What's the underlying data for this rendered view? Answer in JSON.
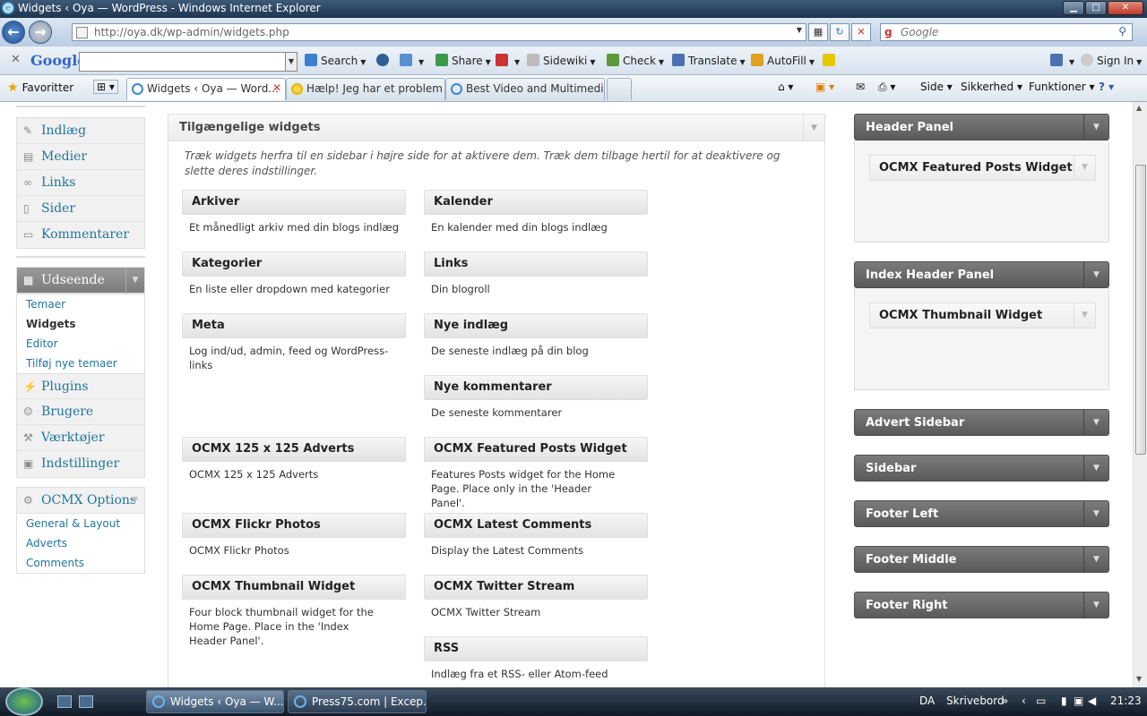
{
  "window": {
    "title": "Widgets ‹ Oya — WordPress - Windows Internet Explorer",
    "controls": {
      "minimize": "▁",
      "maximize": "□",
      "close": "✕"
    }
  },
  "address_bar": {
    "url": "http://oya.dk/wp-admin/widgets.php",
    "search_placeholder": "Google"
  },
  "google_toolbar": {
    "logo": "Google",
    "items": [
      "Search",
      "Share",
      "Sidewiki",
      "Check",
      "Translate",
      "AutoFill"
    ],
    "sign_in": "Sign In"
  },
  "favorites_bar": {
    "favorites_label": "Favoritter",
    "tabs": [
      {
        "label": "Widgets ‹ Oya — Word..."
      },
      {
        "label": "Hælp! Jeg har et problem ..."
      },
      {
        "label": "Best Video and Multimedi..."
      }
    ],
    "commands": [
      "Side",
      "Sikkerhed",
      "Funktioner"
    ]
  },
  "admin_menu": {
    "group1": [
      {
        "label": "Indlæg",
        "icon": "pin-icon"
      },
      {
        "label": "Medier",
        "icon": "media-icon"
      },
      {
        "label": "Links",
        "icon": "link-icon"
      },
      {
        "label": "Sider",
        "icon": "pages-icon"
      },
      {
        "label": "Kommentarer",
        "icon": "comments-icon"
      }
    ],
    "appearance": {
      "label": "Udseende",
      "sub": [
        "Temaer",
        "Widgets",
        "Editor",
        "Tilføj nye temaer"
      ]
    },
    "group2": [
      {
        "label": "Plugins"
      },
      {
        "label": "Brugere"
      },
      {
        "label": "Værktøjer"
      },
      {
        "label": "Indstillinger"
      }
    ],
    "ocmx": {
      "label": "OCMX Options",
      "sub": [
        "General & Layout",
        "Adverts",
        "Comments"
      ]
    }
  },
  "available": {
    "title": "Tilgængelige widgets",
    "description": "Træk widgets herfra til en sidebar i højre side for at aktivere dem. Træk dem tilbage hertil for at deaktivere og slette deres indstillinger.",
    "widgets": [
      {
        "title": "Arkiver",
        "desc": "Et månedligt arkiv med din blogs indlæg"
      },
      {
        "title": "Kalender",
        "desc": "En kalender med din blogs indlæg"
      },
      {
        "title": "Kategorier",
        "desc": "En liste eller dropdown med kategorier"
      },
      {
        "title": "Links",
        "desc": "Din blogroll"
      },
      {
        "title": "Meta",
        "desc": "Log ind/ud, admin, feed og WordPress-links"
      },
      {
        "title": "Nye indlæg",
        "desc": "De seneste indlæg på din blog"
      },
      {
        "title": "Nye kommentarer",
        "desc": "De seneste kommentarer"
      },
      {
        "title": "OCMX 125 x 125 Adverts",
        "desc": "OCMX 125 x 125 Adverts"
      },
      {
        "title": "OCMX Featured Posts Widget",
        "desc": "Features Posts widget for the Home Page. Place only in the 'Header Panel'."
      },
      {
        "title": "OCMX Flickr Photos",
        "desc": "OCMX Flickr Photos"
      },
      {
        "title": "OCMX Latest Comments",
        "desc": "Display the Latest Comments"
      },
      {
        "title": "OCMX Thumbnail Widget",
        "desc": "Four block thumbnail widget for the Home Page. Place in the 'Index Header Panel'."
      },
      {
        "title": "OCMX Twitter Stream",
        "desc": "OCMX Twitter Stream"
      },
      {
        "title": "RSS",
        "desc": "Indlæg fra et RSS- eller Atom-feed"
      }
    ]
  },
  "sidebars": [
    {
      "title": "Header Panel",
      "widget": "OCMX Featured Posts Widget"
    },
    {
      "title": "Index Header Panel",
      "widget": "OCMX Thumbnail Widget"
    },
    {
      "title": "Advert Sidebar"
    },
    {
      "title": "Sidebar"
    },
    {
      "title": "Footer Left"
    },
    {
      "title": "Footer Middle"
    },
    {
      "title": "Footer Right"
    }
  ],
  "taskbar": {
    "buttons": [
      "Widgets ‹ Oya — W...",
      "Press75.com | Excep..."
    ],
    "lang": "DA",
    "desktop": "Skrivebord",
    "time": "21:23"
  }
}
